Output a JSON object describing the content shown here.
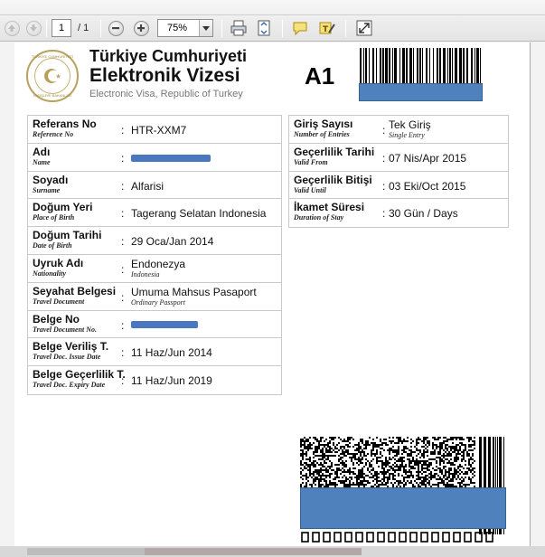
{
  "toolbar": {
    "page_current": "1",
    "page_total": "/ 1",
    "zoom": "75%"
  },
  "document": {
    "header": {
      "title_line1": "Türkiye Cumhuriyeti",
      "title_line2": "Elektronik Vizesi",
      "subtitle": "Electronic Visa, Republic of Turkey",
      "visa_type": "A1",
      "seal_text_top": "TÜRKİYE CUMHURİYETİ",
      "seal_text_bottom": "DIŞİŞLERİ BAKANLIĞI"
    },
    "left_fields": [
      {
        "label": "Referans No",
        "label_en": "Reference No",
        "value": "HTR-XXM7",
        "value_en": ""
      },
      {
        "label": "Adı",
        "label_en": "Name",
        "value": "",
        "value_en": ""
      },
      {
        "label": "Soyadı",
        "label_en": "Surname",
        "value": "Alfarisi",
        "value_en": ""
      },
      {
        "label": "Doğum Yeri",
        "label_en": "Place of Birth",
        "value": "Tagerang Selatan Indonesia",
        "value_en": ""
      },
      {
        "label": "Doğum Tarihi",
        "label_en": "Date of Birth",
        "value": "29 Oca/Jan 2014",
        "value_en": ""
      },
      {
        "label": "Uyruk Adı",
        "label_en": "Nationality",
        "value": "Endonezya",
        "value_en": "Indonesia"
      },
      {
        "label": "Seyahat Belgesi",
        "label_en": "Travel Document",
        "value": "Umuma Mahsus Pasaport",
        "value_en": "Ordinary Passport"
      },
      {
        "label": "Belge No",
        "label_en": "Travel Document No.",
        "value": "",
        "value_en": ""
      },
      {
        "label": "Belge Veriliş T.",
        "label_en": "Travel Doc. Issue Date",
        "value": "11 Haz/Jun 2014",
        "value_en": ""
      },
      {
        "label": "Belge Geçerlilik T.",
        "label_en": "Travel Doc. Expiry Date",
        "value": "11 Haz/Jun 2019",
        "value_en": ""
      }
    ],
    "right_fields": [
      {
        "label": "Giriş Sayısı",
        "label_en": "Number of Entries",
        "value": "Tek Giriş",
        "value_en": "Single Entry"
      },
      {
        "label": "Geçerlilik Tarihi",
        "label_en": "Valid From",
        "value": "07 Nis/Apr 2015",
        "value_en": ""
      },
      {
        "label": "Geçerlilik Bitişi",
        "label_en": "Valid Until",
        "value": "03 Eki/Oct 2015",
        "value_en": ""
      },
      {
        "label": "İkamet Süresi",
        "label_en": "Duration of Stay",
        "value": "30 Gün / Days",
        "value_en": ""
      }
    ],
    "colon": ":"
  },
  "colors": {
    "redaction": "#4f81bd",
    "seal_gold": "#b9a15a"
  },
  "icons": [
    "arrow-up-icon",
    "arrow-down-icon",
    "zoom-out-icon",
    "zoom-in-icon",
    "print-icon",
    "fit-page-icon",
    "comment-icon",
    "sign-icon",
    "expand-icon"
  ]
}
